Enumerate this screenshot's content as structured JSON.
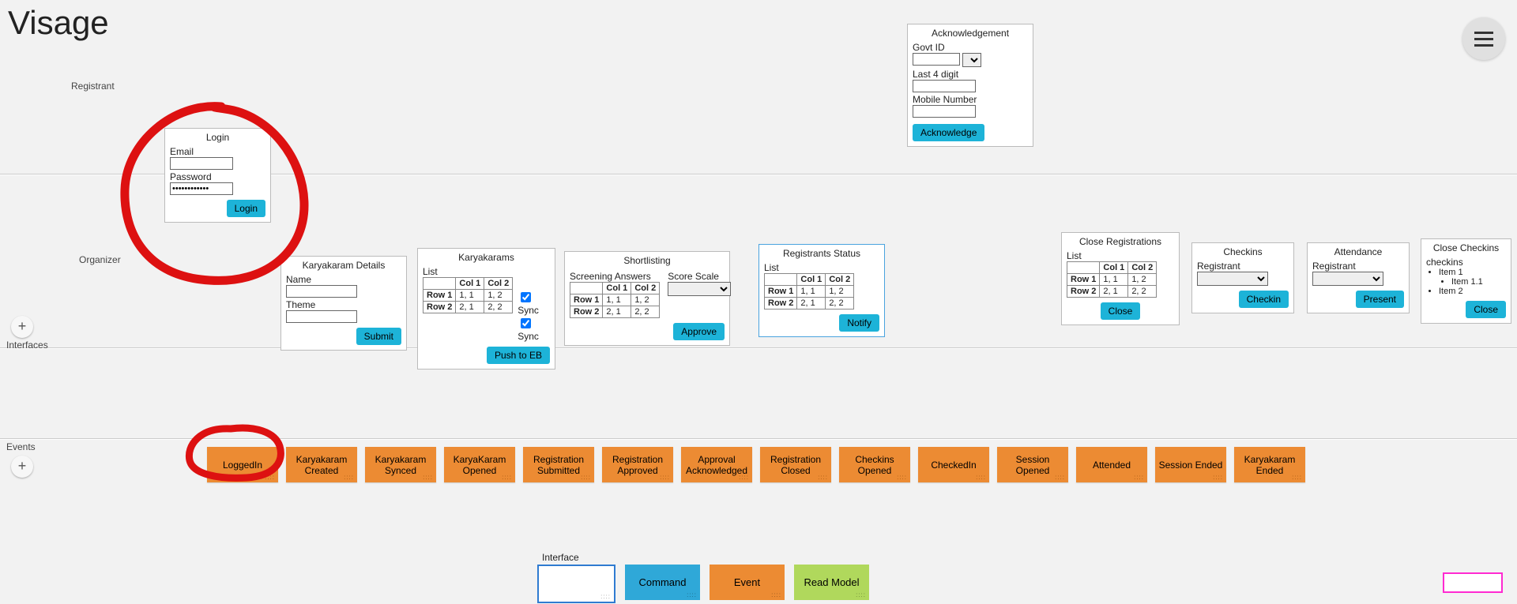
{
  "app": {
    "title": "Visage"
  },
  "sections": {
    "registrant": "Registrant",
    "organizer": "Organizer",
    "interfaces": "Interfaces",
    "events": "Events"
  },
  "login": {
    "title": "Login",
    "email_label": "Email",
    "password_label": "Password",
    "password_value": "************",
    "button": "Login"
  },
  "ack": {
    "title": "Acknowledgement",
    "govt_label": "Govt ID",
    "last4_label": "Last 4 digit",
    "mobile_label": "Mobile Number",
    "button": "Acknowledge"
  },
  "karyakaram_details": {
    "title": "Karyakaram Details",
    "name_label": "Name",
    "theme_label": "Theme",
    "button": "Submit"
  },
  "karyakarams": {
    "title": "Karyakarams",
    "list_label": "List",
    "button": "Push to EB",
    "sync": "Sync"
  },
  "shortlisting": {
    "title": "Shortlisting",
    "screening_label": "Screening Answers",
    "scorescale_label": "Score Scale",
    "button": "Approve"
  },
  "reg_status": {
    "title": "Registrants Status",
    "list_label": "List",
    "button": "Notify"
  },
  "close_regs": {
    "title": "Close Registrations",
    "list_label": "List",
    "button": "Close"
  },
  "checkins": {
    "title": "Checkins",
    "registrant_label": "Registrant",
    "button": "Checkin"
  },
  "attendance": {
    "title": "Attendance",
    "registrant_label": "Registrant",
    "button": "Present"
  },
  "close_checkins": {
    "title": "Close Checkins",
    "list_label": "checkins",
    "items": [
      "Item 1",
      "Item 1.1",
      "Item 2"
    ],
    "button": "Close"
  },
  "table": {
    "corner": "",
    "cols": [
      "Col 1",
      "Col 2"
    ],
    "rows": [
      {
        "h": "Row 1",
        "c": [
          "1, 1",
          "1, 2"
        ]
      },
      {
        "h": "Row 2",
        "c": [
          "2, 1",
          "2, 2"
        ]
      }
    ]
  },
  "events": [
    "LoggedIn",
    "Karyakaram Created",
    "Karyakaram Synced",
    "KaryaKaram Opened",
    "Registration Submitted",
    "Registration Approved",
    "Approval Acknowledged",
    "Registration Closed",
    "Checkins Opened",
    "CheckedIn",
    "Session Opened",
    "Attended",
    "Session Ended",
    "Karyakaram Ended"
  ],
  "legend": {
    "interface": "Interface",
    "command": "Command",
    "event": "Event",
    "readmodel": "Read Model"
  }
}
